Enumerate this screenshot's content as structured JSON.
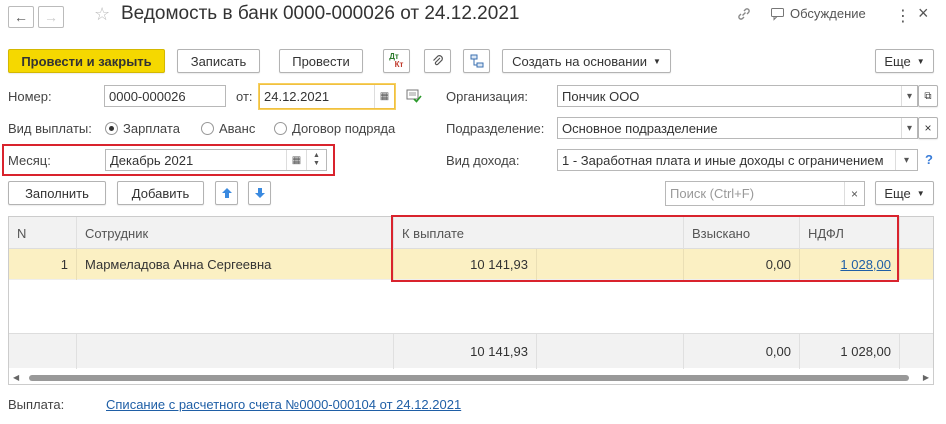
{
  "header": {
    "back_glyph": "←",
    "forward_glyph": "→",
    "star_glyph": "☆",
    "title": "Ведомость в банк 0000-000026 от 24.12.2021",
    "link_glyph": "🔗",
    "discussion_label": "Обсуждение",
    "more_glyph": "⋮",
    "close_glyph": "×"
  },
  "toolbar": {
    "post_close": "Провести и закрыть",
    "save": "Записать",
    "post": "Провести",
    "dt_kt_top": "Дт",
    "dt_kt_bottom": "Кт",
    "create_based_on": "Создать на основании",
    "more": "Еще"
  },
  "form": {
    "number_label": "Номер:",
    "number_value": "0000-000026",
    "date_from_label": "от:",
    "date_value": "24.12.2021",
    "organization_label": "Организация:",
    "organization_value": "Пончик ООО",
    "payment_type_label": "Вид выплаты:",
    "payment_options": [
      "Зарплата",
      "Аванс",
      "Договор подряда"
    ],
    "payment_selected": 0,
    "division_label": "Подразделение:",
    "division_value": "Основное подразделение",
    "month_label": "Месяц:",
    "month_value": "Декабрь 2021",
    "income_type_label": "Вид дохода:",
    "income_type_value": "1 - Заработная плата и иные доходы с ограничением",
    "help_glyph": "?"
  },
  "table_toolbar": {
    "fill": "Заполнить",
    "add": "Добавить",
    "search_placeholder": "Поиск (Ctrl+F)",
    "more": "Еще"
  },
  "table": {
    "columns": [
      "N",
      "Сотрудник",
      "К выплате",
      "Взыскано",
      "НДФЛ"
    ],
    "rows": [
      {
        "n": "1",
        "employee": "Мармеладова Анна Сергеевна",
        "to_pay": "10 141,93",
        "withheld": "0,00",
        "ndfl": "1 028,00"
      }
    ],
    "totals": {
      "to_pay": "10 141,93",
      "withheld": "0,00",
      "ndfl": "1 028,00"
    }
  },
  "footer": {
    "payment_label": "Выплата:",
    "payment_link": "Списание с расчетного счета №0000-000104 от 24.12.2021"
  },
  "colors": {
    "primary_button": "#f5d800",
    "highlight_box": "#d9232d",
    "selected_row": "#fbf0c3",
    "link": "#1f5fa6"
  }
}
